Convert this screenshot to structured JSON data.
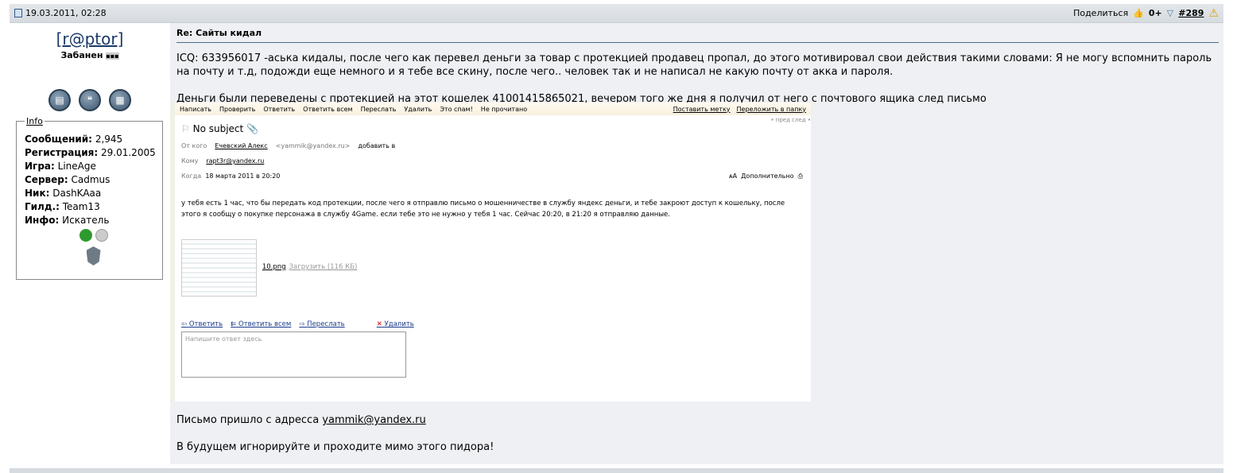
{
  "post": {
    "date": "19.03.2011, 02:28",
    "share_label": "Поделиться",
    "rating": "0+",
    "post_number": "#289"
  },
  "user": {
    "name": "[r@ptor]",
    "status": "Забанен",
    "info_title": "Info",
    "fields": [
      {
        "label": "Сообщений:",
        "value": "2,945"
      },
      {
        "label": "Регистрация:",
        "value": "29.01.2005"
      },
      {
        "label": "Игра:",
        "value": "LineAge"
      },
      {
        "label": "Сервер:",
        "value": "Cadmus"
      },
      {
        "label": "Ник:",
        "value": "DashKAaa"
      },
      {
        "label": "Гилд.:",
        "value": "Team13"
      },
      {
        "label": "Инфо:",
        "value": "Искатель"
      }
    ]
  },
  "content": {
    "title": "Re: Сайты кидал",
    "paragraph1": "ICQ: 633956017 -аська кидалы, после чего как перевел деньги за товар с протекцией продавец пропал, до этого мотивировал свои действия такими словами: Я не могу вспомнить пароль на почту и т.д, подожди еще немного и я тебе все скину, после чего.. человек так и не написал не какую почту от акка и пароля.",
    "paragraph2": "Деньги были переведены с протекцией на этот кошелек 41001415865021, вечером того же дня я получил от него с почтового ящика след письмо",
    "after1_prefix": "Письмо пришло с адресса ",
    "after1_email": "yammik@yandex.ru",
    "after2": "В будущем игнорируйте и проходите мимо этого пидора!"
  },
  "mail": {
    "toolbar": [
      "Написать",
      "Проверить",
      "Ответить",
      "Ответить всем",
      "Переслать",
      "Удалить",
      "Это спам!",
      "Не прочитано"
    ],
    "toolbar_right": [
      "Поставить метку",
      "Переложить в папку"
    ],
    "nav": "• пред   след •",
    "subject": "No subject",
    "from_label": "От кого",
    "from_value": "Ечевский Алекс",
    "from_email": "<yammik@yandex.ru>",
    "from_add": "добавить в",
    "to_label": "Кому",
    "to_value": "rapt3r@yandex.ru",
    "when_label": "Когда",
    "when_value": "18 марта 2011 в 20:20",
    "extra": "Дополнительно",
    "text": "у тебя есть 1 час, что бы передать код протекции, после чего я отправлю письмо о мошенничестве в службу яндекс деньги, и тебе закроют доступ к кошельку, после этого я сообщу о покупке персонажа в службу 4Game. если тебе это не нужно у тебя 1 час. Сейчас 20:20, в 21:20 я отправляю данные.",
    "attachment": "10.png",
    "attachment_size": "Загрузить (116 КБ)",
    "actions": [
      "Ответить",
      "Ответить всем",
      "Переслать",
      "Удалить"
    ],
    "reply_placeholder": "Напишите ответ здесь"
  }
}
